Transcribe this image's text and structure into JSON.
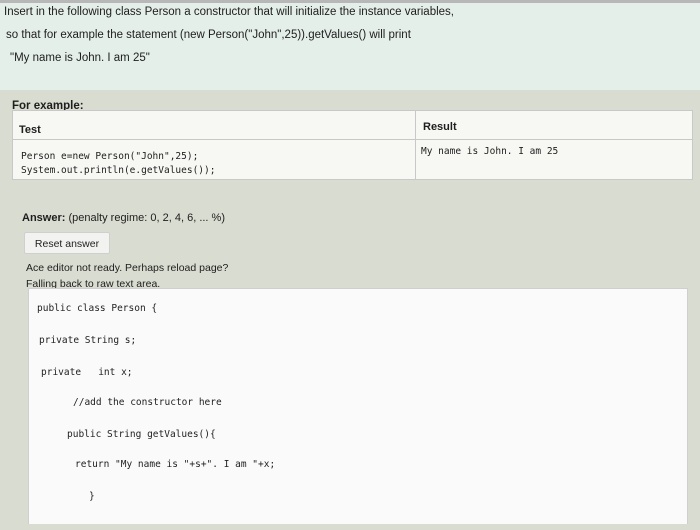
{
  "question": {
    "line1": "Insert in the following class Person a constructor that will initialize the instance variables,",
    "line2": "so that for example the statement (new Person(\"John\",25)).getValues() will print",
    "line3": "\"My name is John. I am 25\""
  },
  "example": {
    "label": "For example:",
    "headers": {
      "test": "Test",
      "result": "Result"
    },
    "test_lines": [
      "Person e=new Person(\"John\",25);",
      "System.out.println(e.getValues());"
    ],
    "result": "My name is John. I am 25"
  },
  "answer": {
    "label": "Answer:",
    "penalty": "(penalty regime: 0, 2, 4, 6, ... %)",
    "reset_label": "Reset answer",
    "ace_msg1": "Ace editor not ready. Perhaps reload page?",
    "ace_msg2": "Falling back to raw text area."
  },
  "code": {
    "lines": [
      "public class Person {",
      "private String s;",
      "private   int x;",
      "//add the constructor here",
      "public String getValues(){",
      "return \"My name is \"+s+\". I am \"+x;",
      "}"
    ]
  }
}
